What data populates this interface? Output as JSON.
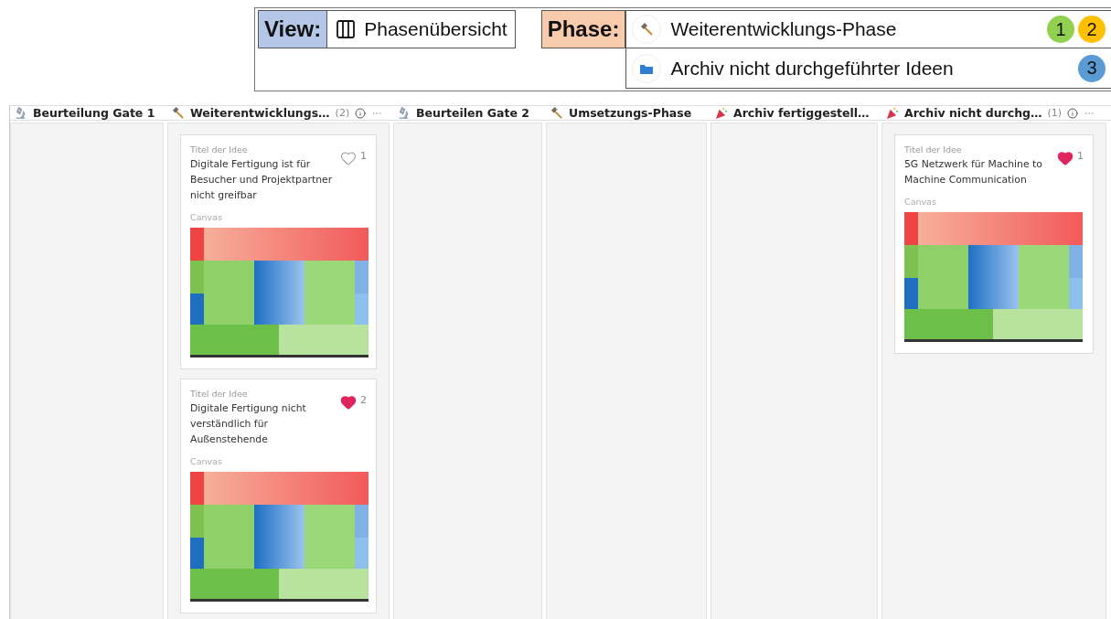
{
  "view": {
    "label": "View:",
    "value": "Phasenübersicht"
  },
  "phase_legend": {
    "label": "Phase:",
    "items": [
      {
        "kind": "build",
        "name": "Weiterentwicklungs-Phase",
        "markers": [
          {
            "text": "1",
            "color": "#92d050"
          },
          {
            "text": "2",
            "color": "#ffc000"
          }
        ]
      },
      {
        "kind": "archive",
        "name": "Archiv nicht durchgeführter Ideen",
        "markers": [
          {
            "text": "3",
            "color": "#5b9bd5"
          }
        ]
      }
    ]
  },
  "board": {
    "columns": [
      {
        "kind": "review",
        "title": "Beurteilung Gate 1"
      },
      {
        "kind": "build",
        "title": "Weiterentwicklungs…",
        "count": "(2)",
        "cards": [
          {
            "label": "Titel der Idee",
            "title": "Digitale Fertigung ist für Besucher und Projektpartner nicht greifbar",
            "liked": false,
            "likes": "1",
            "canvas_label": "Canvas"
          },
          {
            "label": "Titel der Idee",
            "title": "Digitale Fertigung nicht verständlich für Außenstehende",
            "liked": true,
            "likes": "2",
            "canvas_label": "Canvas"
          }
        ]
      },
      {
        "kind": "review",
        "title": "Beurteilen Gate 2"
      },
      {
        "kind": "build",
        "title": "Umsetzungs-Phase"
      },
      {
        "kind": "done",
        "title": "Archiv fertiggestell…"
      },
      {
        "kind": "done",
        "title": "Archiv nicht durchg…",
        "count": "(1)",
        "cards": [
          {
            "label": "Titel der Idee",
            "title": "5G Netzwerk für Machine to Machine Communication",
            "liked": true,
            "likes": "1",
            "canvas_label": "Canvas"
          }
        ]
      }
    ]
  }
}
